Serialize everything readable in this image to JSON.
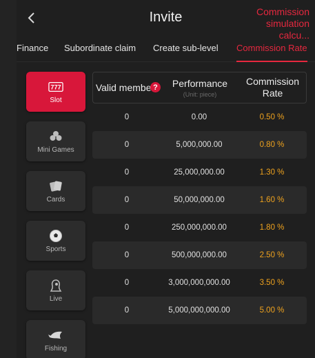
{
  "header": {
    "title": "Invite",
    "simulation_link": "Commission simulation calcu..."
  },
  "tabs": [
    {
      "label": "Finance",
      "active": false
    },
    {
      "label": "Subordinate claim",
      "active": false
    },
    {
      "label": "Create sub-level",
      "active": false
    },
    {
      "label": "Commission Rate",
      "active": true
    }
  ],
  "categories": [
    {
      "label": "Slot",
      "icon": "slot-777-icon",
      "active": true
    },
    {
      "label": "Mini Games",
      "icon": "clover-icon",
      "active": false
    },
    {
      "label": "Cards",
      "icon": "playing-cards-icon",
      "active": false
    },
    {
      "label": "Sports",
      "icon": "soccer-ball-icon",
      "active": false
    },
    {
      "label": "Live",
      "icon": "live-dealer-icon",
      "active": false
    },
    {
      "label": "Fishing",
      "icon": "fish-icon",
      "active": false
    }
  ],
  "table": {
    "headers": {
      "valid_members": "Valid members",
      "performance": "Performance",
      "performance_unit": "(Unit: piece)",
      "commission_rate": "Commission Rate"
    },
    "rows": [
      {
        "members": "0",
        "performance": "0.00",
        "rate": "0.50 %"
      },
      {
        "members": "0",
        "performance": "5,000,000.00",
        "rate": "0.80 %"
      },
      {
        "members": "0",
        "performance": "25,000,000.00",
        "rate": "1.30 %"
      },
      {
        "members": "0",
        "performance": "50,000,000.00",
        "rate": "1.60 %"
      },
      {
        "members": "0",
        "performance": "250,000,000.00",
        "rate": "1.80 %"
      },
      {
        "members": "0",
        "performance": "500,000,000.00",
        "rate": "2.50 %"
      },
      {
        "members": "0",
        "performance": "3,000,000,000.00",
        "rate": "3.50 %"
      },
      {
        "members": "0",
        "performance": "5,000,000,000.00",
        "rate": "5.00 %"
      }
    ]
  },
  "colors": {
    "accent": "#d8173a",
    "rate": "#f0a31e",
    "background": "#1f1f1f"
  }
}
